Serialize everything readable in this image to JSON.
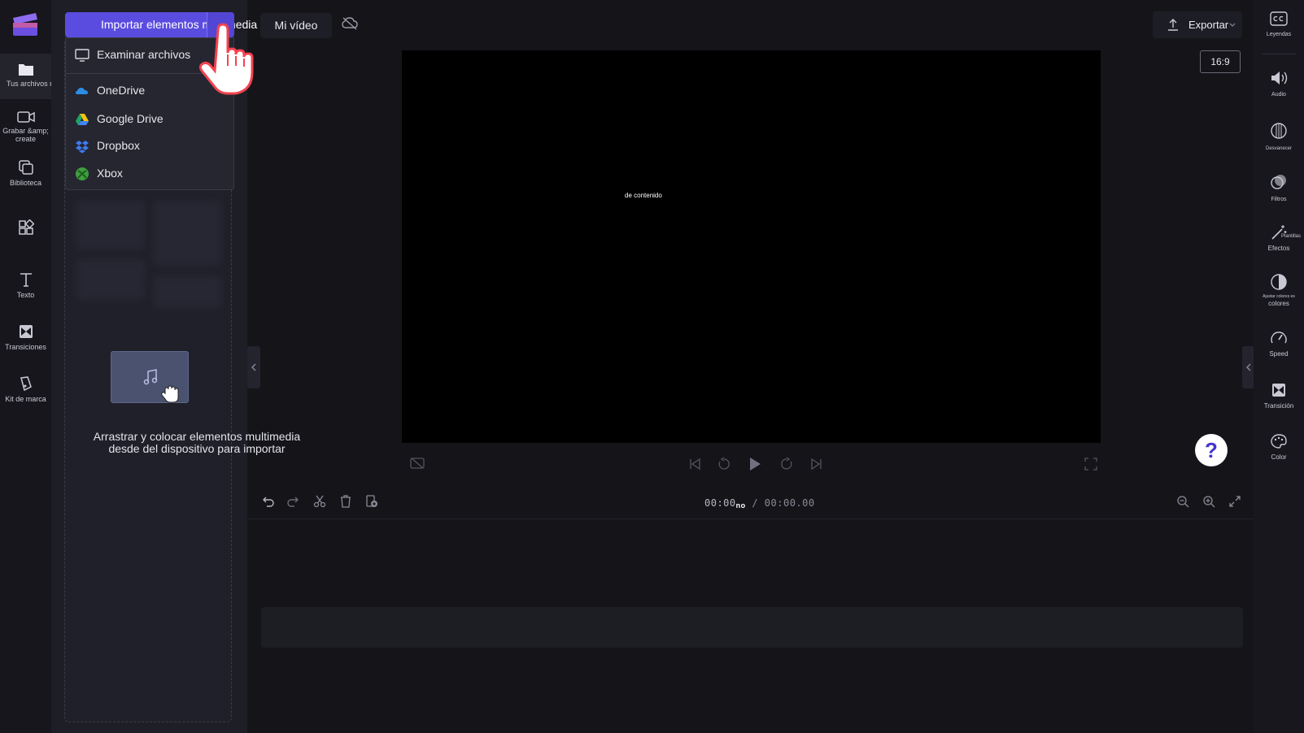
{
  "app": {
    "brand_color": "#5b4ce0",
    "logo_icon": "clipchamp-logo-icon"
  },
  "left_rail": {
    "items": [
      {
        "label": "Tus archivos multimedia",
        "icon": "folder-icon"
      },
      {
        "label": "Grabar &amp; create",
        "icon": "video-camera-icon"
      },
      {
        "label": "Biblioteca",
        "icon": "library-icon"
      },
      {
        "label": "",
        "icon": "templates-grid-icon"
      },
      {
        "label": "Texto",
        "icon": "text-icon"
      },
      {
        "label": "Transiciones",
        "icon": "transition-icon"
      },
      {
        "label": "Kit de marca",
        "icon": "brand-kit-icon"
      }
    ]
  },
  "import": {
    "button_label": "Importar elementos multimedia",
    "menu": [
      {
        "label": "Examinar archivos",
        "icon": "monitor-icon"
      },
      {
        "label": "OneDrive",
        "icon": "onedrive-icon"
      },
      {
        "label": "Google Drive",
        "icon": "google-drive-icon"
      },
      {
        "label": "Dropbox",
        "icon": "dropbox-icon"
      },
      {
        "label": "Xbox",
        "icon": "xbox-icon"
      }
    ]
  },
  "media_panel": {
    "drop_text": "Arrastrar y colocar elementos multimedia desde del dispositivo para importar"
  },
  "topbar": {
    "project_title": "Mi vídeo",
    "export_label": "Exportar",
    "aspect_ratio": "16:9"
  },
  "preview": {
    "overlay_text": "de contenido"
  },
  "timeline": {
    "current_time": "00:00",
    "current_suffix": "no",
    "total_time": "/ 00:00.00"
  },
  "right_rail": {
    "items": [
      {
        "label": "Leyendas",
        "icon": "captions-icon"
      },
      {
        "label": "Audio",
        "icon": "speaker-icon"
      },
      {
        "label": "Desvanecer",
        "icon": "fade-icon"
      },
      {
        "label": "Filtros",
        "icon": "filters-icon"
      },
      {
        "label_top": "Plantillas",
        "label": "Efectos",
        "icon": "magic-wand-icon"
      },
      {
        "label_top": "Ajustar colores es",
        "label": "colores",
        "icon": "adjust-colors-icon"
      },
      {
        "label": "Speed",
        "icon": "speed-gauge-icon"
      },
      {
        "label": "Transición",
        "icon": "transition-icon"
      },
      {
        "label": "Color",
        "icon": "palette-icon"
      }
    ]
  },
  "help": {
    "label": "?"
  }
}
